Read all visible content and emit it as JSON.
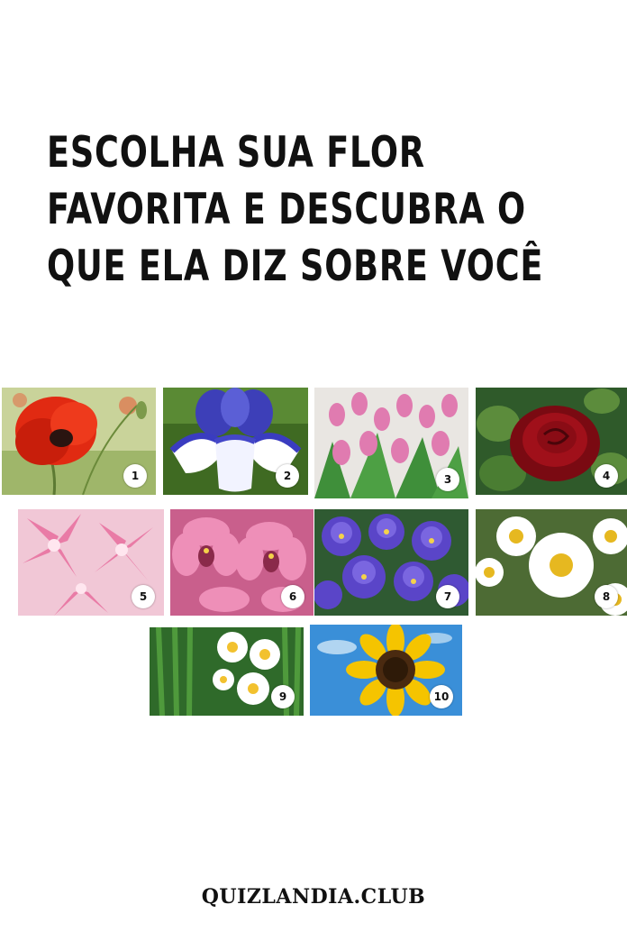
{
  "title_lines": [
    "ESCOLHA SUA FLOR",
    "FAVORITA E DESCUBRA O",
    "QUE ELA DIZ SOBRE VOCÊ"
  ],
  "flowers": [
    {
      "number": "1",
      "icon": "red-poppy-icon"
    },
    {
      "number": "2",
      "icon": "blue-iris-icon"
    },
    {
      "number": "3",
      "icon": "pink-tulips-icon"
    },
    {
      "number": "4",
      "icon": "red-rose-icon"
    },
    {
      "number": "5",
      "icon": "pink-lily-icon"
    },
    {
      "number": "6",
      "icon": "pink-orchid-icon"
    },
    {
      "number": "7",
      "icon": "purple-violet-icon"
    },
    {
      "number": "8",
      "icon": "chamomile-daisy-icon"
    },
    {
      "number": "9",
      "icon": "white-narcissus-icon"
    },
    {
      "number": "10",
      "icon": "sunflower-icon"
    }
  ],
  "footer": "QUIZLANDIA.CLUB"
}
